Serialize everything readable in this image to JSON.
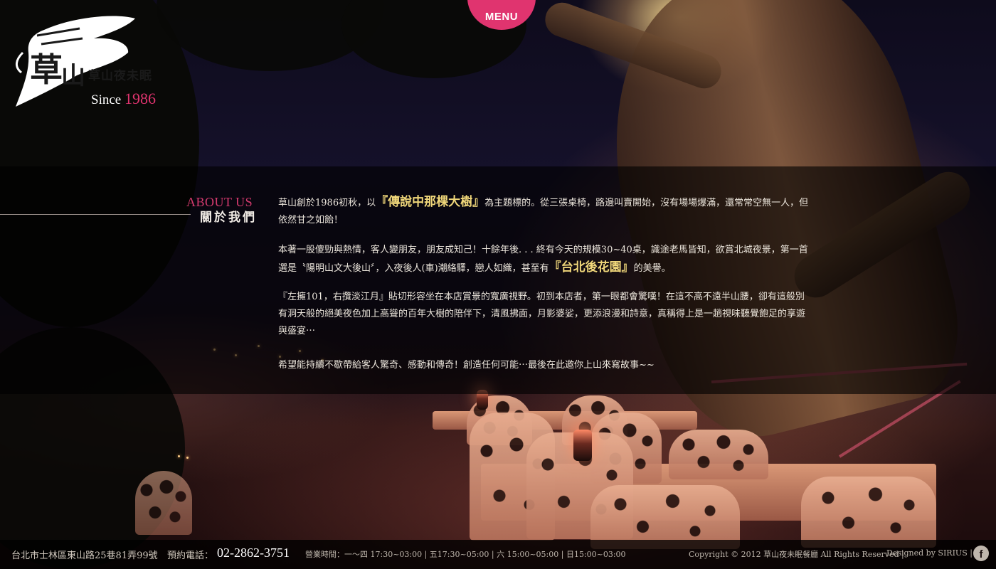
{
  "nav": {
    "menu_label": "MENU"
  },
  "logo": {
    "name": "草山夜未眠",
    "since_text": "Since",
    "since_year": "1986"
  },
  "about": {
    "heading_en": "ABOUT US",
    "heading_zh": "關於我們",
    "p1_a": "草山創於1986初秋，以",
    "p1_hl": "『傳說中那棵大樹』",
    "p1_b": "為主題標的。從三張桌椅，路邊叫賣開始，沒有場場爆滿，還常常空無一人，但依然甘之如飴！",
    "p2_a": "本著一股傻勁與熱情，客人變朋友，朋友成知己！十餘年後. . . 終有今天的規模30~40桌，識途老馬皆知，欲賞北城夜景，第一首選是〝陽明山文大後山〞，入夜後人(車)潮絡驛，戀人如織，甚至有",
    "p2_hl": "『台北後花園』",
    "p2_b": "的美譽。",
    "p3": "『左擁101，右攬淡江月』貼切形容坐在本店賞景的寬廣視野。初到本店者，第一眼都會驚嘆！在這不高不遠半山腰，卻有這般別有洞天般的絕美夜色加上高聳的百年大樹的陪伴下，清風拂面，月影婆娑，更添浪漫和詩意，真稱得上是一趟視味聽覺飽足的享遊與盛宴⋯",
    "p4": "希望能持續不歇帶給客人驚奇、感動和傳奇！創造任何可能⋯最後在此邀你上山來寫故事~~"
  },
  "footer": {
    "address": "台北市士林區東山路25巷81弄99號",
    "tel_label": "預約電話：",
    "tel": "02-2862-3751",
    "hours": "營業時間：一～四 17:30~03:00 | 五17:30~05:00 | 六 15:00~05:00 | 日15:00~03:00",
    "copyright": "Copyright © 2012 草山夜未眠餐廳 All Rights Reserved  |",
    "designed_by": "Designed by SIRIUS |",
    "facebook_icon_glyph": "f"
  },
  "colors": {
    "accent": "#e0346f",
    "highlight": "#f0d77a"
  }
}
